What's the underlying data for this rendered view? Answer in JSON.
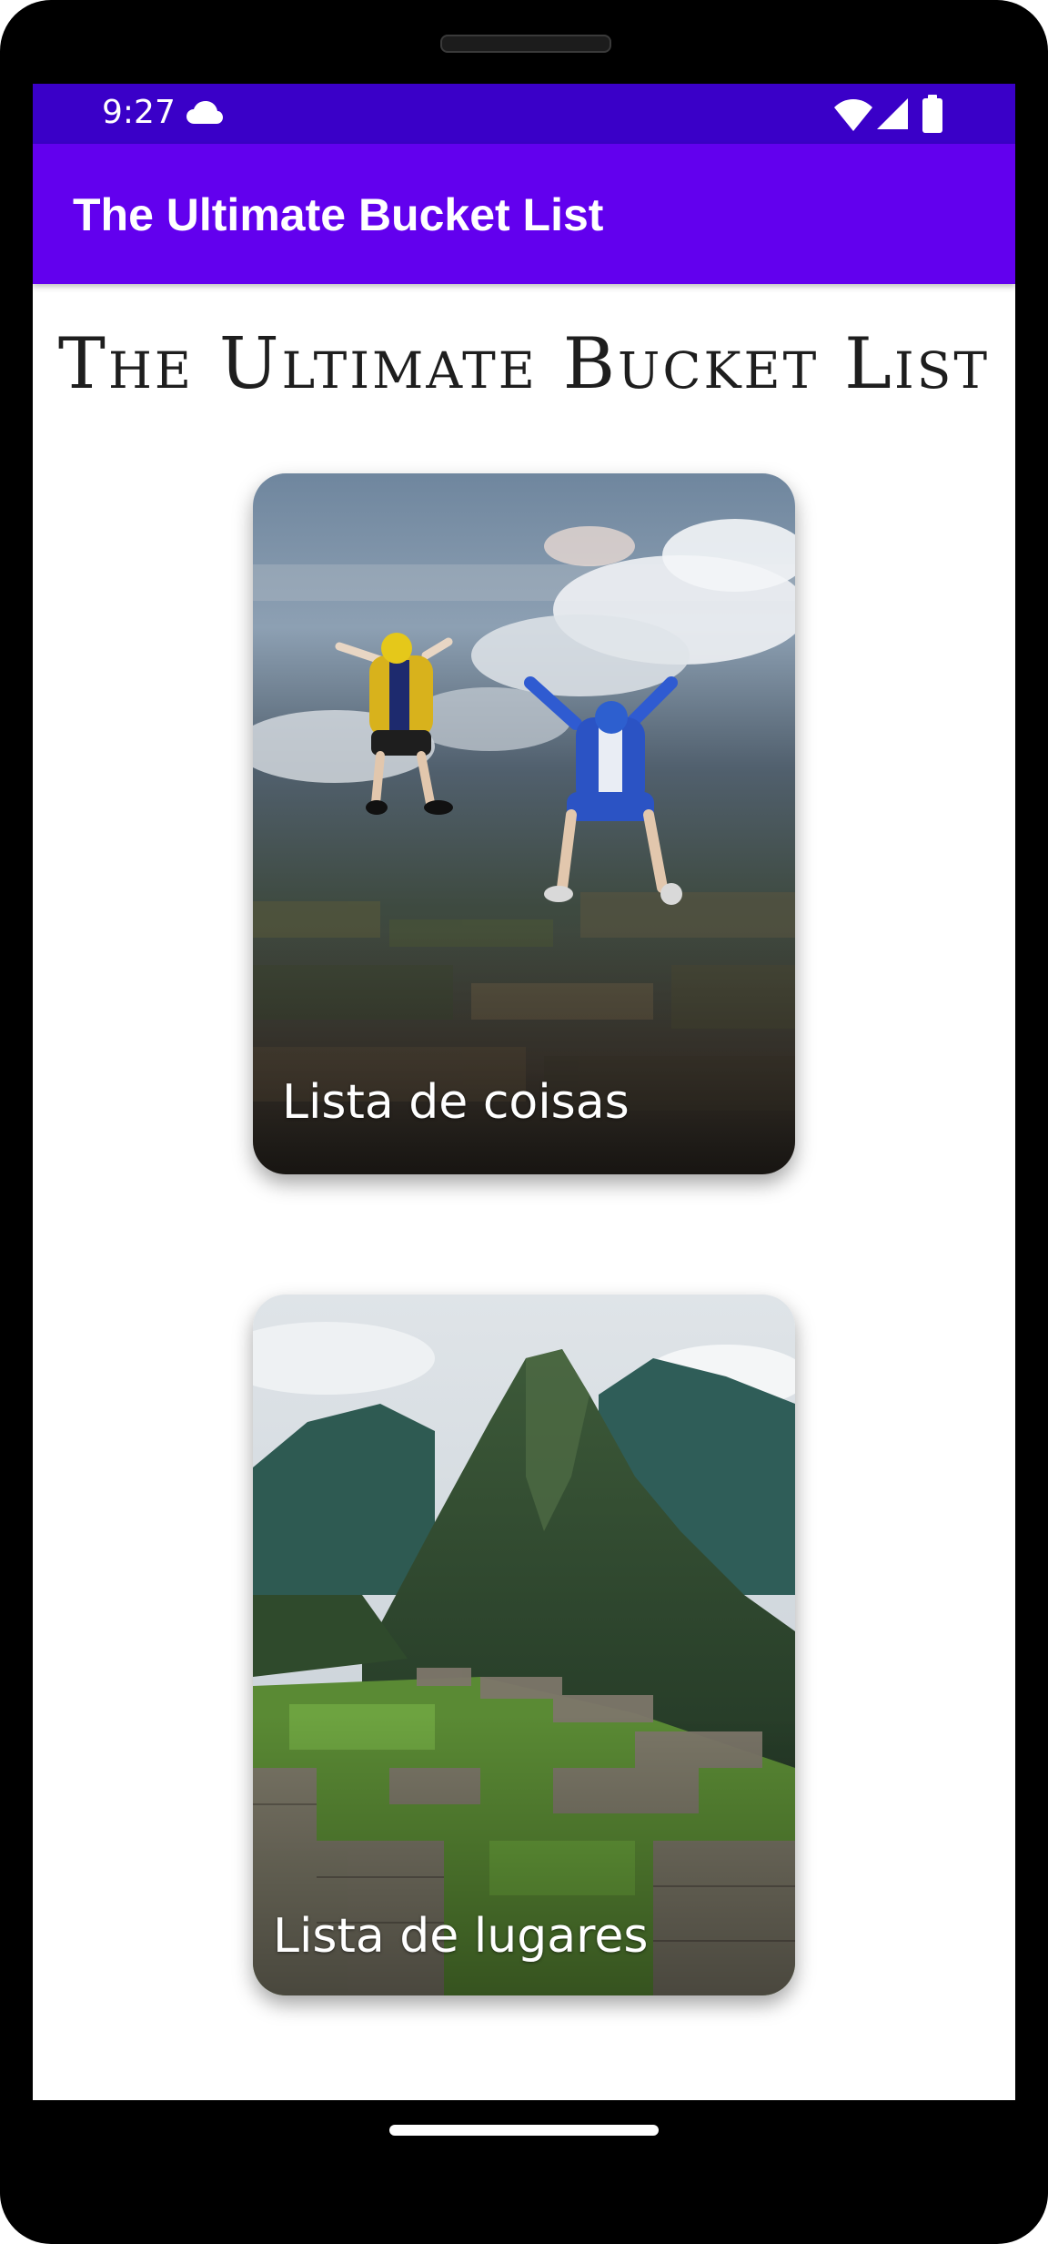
{
  "status_bar": {
    "time": "9:27",
    "icons": [
      "cloud-icon",
      "wifi-icon",
      "signal-icon",
      "battery-icon"
    ],
    "color": "#3a00c8"
  },
  "app_bar": {
    "title": "The Ultimate Bucket List",
    "color": "#6200ee"
  },
  "page": {
    "heading": "The Ultimate Bucket List"
  },
  "cards": [
    {
      "label": "Lista de coisas",
      "image": "skydivers-in-free-fall-over-farmland"
    },
    {
      "label": "Lista de lugares",
      "image": "mountain-with-ancient-stone-ruins"
    }
  ]
}
